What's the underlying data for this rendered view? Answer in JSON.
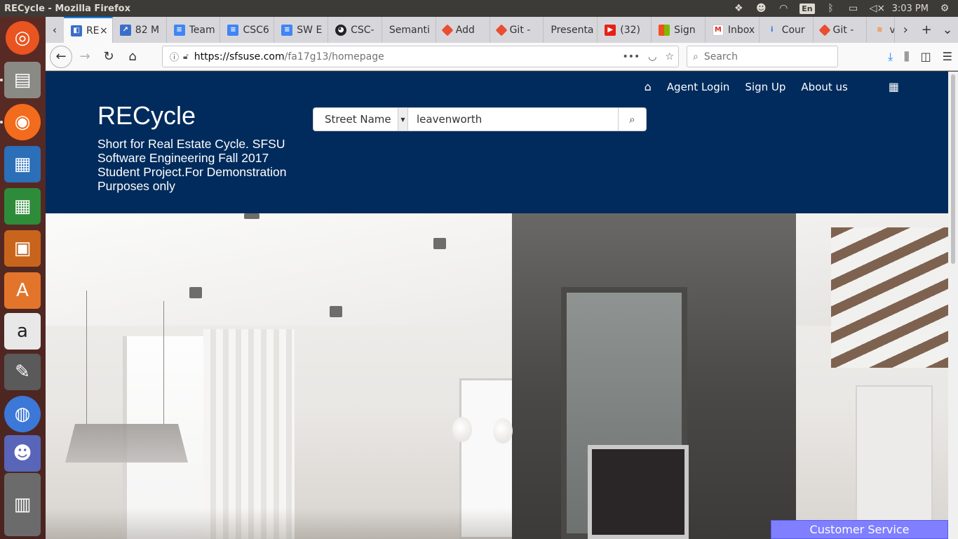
{
  "os": {
    "window_title": "RECycle - Mozilla Firefox",
    "tray": {
      "keyboard_layout": "En",
      "clock": "3:03 PM"
    }
  },
  "launcher": {
    "apps": [
      "ubuntu-dash",
      "files",
      "firefox",
      "libreoffice-writer",
      "libreoffice-calc",
      "libreoffice-impress",
      "software-center",
      "amazon",
      "system-settings",
      "chromium",
      "discord",
      "stacked-apps"
    ]
  },
  "browser": {
    "tabs": [
      {
        "label": "RE",
        "favicon": "csc-doc",
        "active": true
      },
      {
        "label": "82 M",
        "favicon": "pivotal"
      },
      {
        "label": "Team",
        "favicon": "gdocs"
      },
      {
        "label": "CSC6",
        "favicon": "gdocs"
      },
      {
        "label": "SW E",
        "favicon": "gdocs"
      },
      {
        "label": "CSC-",
        "favicon": "github"
      },
      {
        "label": "Semanti",
        "favicon": "none"
      },
      {
        "label": "Add",
        "favicon": "git"
      },
      {
        "label": "Git -",
        "favicon": "git"
      },
      {
        "label": "Presenta",
        "favicon": "none"
      },
      {
        "label": "(32)",
        "favicon": "youtube"
      },
      {
        "label": "Sign",
        "favicon": "microsoft"
      },
      {
        "label": "Inbox",
        "favicon": "gmail"
      },
      {
        "label": "Cour",
        "favicon": "info"
      },
      {
        "label": "Git -",
        "favicon": "git"
      },
      {
        "label": "ve",
        "favicon": "stack"
      }
    ],
    "url": {
      "domain": "https://sfsuse.com",
      "path": "/fa17g13/homepage"
    },
    "search_placeholder": "Search"
  },
  "site": {
    "nav": {
      "agent_login": "Agent Login",
      "sign_up": "Sign Up",
      "about_us": "About us"
    },
    "brand": "RECycle",
    "tagline": "Short for Real Estate Cycle. SFSU Software Engineering Fall 2017 Student Project.For Demonstration Purposes only",
    "search": {
      "filter": "Street Name",
      "query": "leavenworth"
    },
    "customer_service": "Customer Service",
    "colors": {
      "header_bg": "#002b5c",
      "cs_bg": "#7f7fff"
    }
  }
}
